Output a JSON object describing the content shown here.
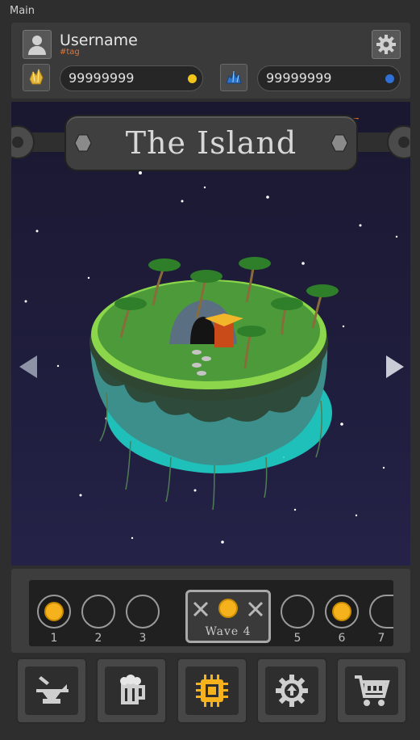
{
  "window": {
    "title": "Main"
  },
  "header": {
    "username": "Username",
    "tag": "#tag",
    "gold": {
      "value": "99999999",
      "icon": "gold-crystal-icon",
      "dot_color": "#f0c419"
    },
    "gems": {
      "value": "99999999",
      "icon": "blue-gem-icon",
      "dot_color": "#2f6fd6"
    }
  },
  "scene": {
    "title": "The Island",
    "prev_icon": "arrow-left-icon",
    "next_icon": "arrow-right-icon"
  },
  "waves": {
    "items": [
      {
        "label": "1",
        "completed": true
      },
      {
        "label": "2",
        "completed": false
      },
      {
        "label": "3",
        "completed": false
      },
      {
        "label": "5",
        "completed": false
      },
      {
        "label": "6",
        "completed": true
      },
      {
        "label": "7",
        "completed": false
      }
    ],
    "current": {
      "label": "Wave 4"
    }
  },
  "toolbar": {
    "items": [
      {
        "name": "anvil-icon"
      },
      {
        "name": "beer-mug-icon"
      },
      {
        "name": "chip-icon",
        "active": true,
        "color": "#f5b21d"
      },
      {
        "name": "upgrade-gear-icon"
      },
      {
        "name": "shop-cart-icon"
      }
    ]
  }
}
